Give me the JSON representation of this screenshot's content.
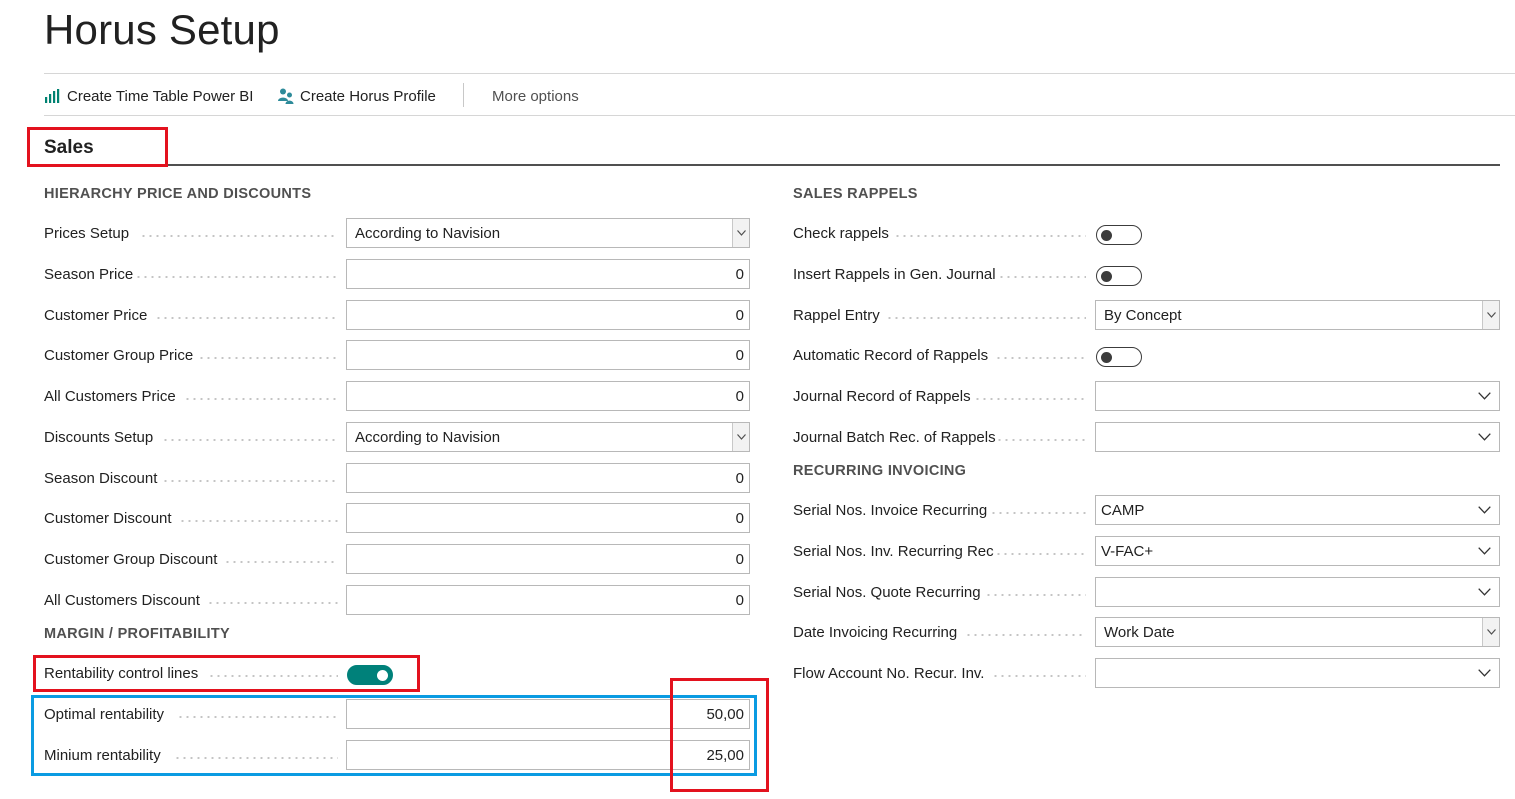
{
  "page": {
    "title": "Horus Setup"
  },
  "actions": {
    "create_timetable": "Create Time Table Power BI",
    "create_profile": "Create Horus Profile",
    "more_options": "More options"
  },
  "section": {
    "title": "Sales"
  },
  "left": {
    "group_hierarchy": "HIERARCHY PRICE AND DISCOUNTS",
    "fields": [
      {
        "label": "Prices Setup",
        "value": "According to Navision"
      },
      {
        "label": "Season Price",
        "value": "0"
      },
      {
        "label": "Customer Price",
        "value": "0"
      },
      {
        "label": "Customer Group Price",
        "value": "0"
      },
      {
        "label": "All Customers Price",
        "value": "0"
      },
      {
        "label": "Discounts Setup",
        "value": "According to Navision"
      },
      {
        "label": "Season Discount",
        "value": "0"
      },
      {
        "label": "Customer Discount",
        "value": "0"
      },
      {
        "label": "Customer Group Discount",
        "value": "0"
      },
      {
        "label": "All Customers Discount",
        "value": "0"
      }
    ],
    "group_margin": "MARGIN / PROFITABILITY",
    "margin": {
      "rentability_label": "Rentability control lines",
      "rentability_on": true,
      "optimal_label": "Optimal rentability",
      "optimal_value": "50,00",
      "minimum_label": "Minium rentability",
      "minimum_value": "25,00"
    }
  },
  "right": {
    "group_rappels": "SALES RAPPELS",
    "rappels": [
      {
        "label": "Check rappels",
        "on": false
      },
      {
        "label": "Insert Rappels in Gen. Journal",
        "on": false
      },
      {
        "label": "Rappel Entry",
        "value": "By Concept"
      },
      {
        "label": "Automatic Record of Rappels",
        "on": false
      },
      {
        "label": "Journal Record of Rappels",
        "value": ""
      },
      {
        "label": "Journal Batch Rec. of Rappels",
        "value": ""
      }
    ],
    "group_recurring": "RECURRING INVOICING",
    "recurring": [
      {
        "label": "Serial Nos. Invoice Recurring",
        "value": "CAMP"
      },
      {
        "label": "Serial Nos. Inv. Recurring Rec",
        "value": "V-FAC+"
      },
      {
        "label": "Serial Nos. Quote Recurring",
        "value": ""
      },
      {
        "label": "Date Invoicing Recurring",
        "value": "Work Date"
      },
      {
        "label": "Flow Account No. Recur. Inv.",
        "value": ""
      }
    ]
  },
  "colors": {
    "accent_toggle": "#00817a",
    "highlight_red": "#e3121e",
    "highlight_blue": "#0a9be2",
    "powerbi_icon": "#008272",
    "profile_icon": "#2e8b9a"
  }
}
